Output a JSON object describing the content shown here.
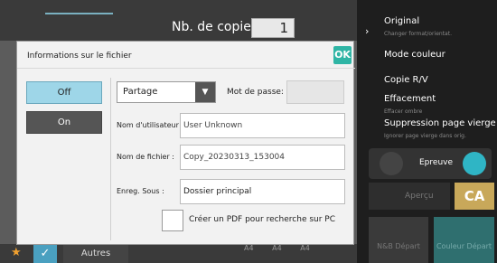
{
  "background": {
    "copies_label": "Nb. de copies",
    "copies_value": "1",
    "right_panel": {
      "original_label": "Original",
      "original_sub": "Changer format/orientat.",
      "mode_couleur": "Mode couleur",
      "copie_rv": "Copie R/V",
      "effacement": "Effacement",
      "effacement_sub": "Effacer ombre",
      "suppression": "Suppression page vierge",
      "suppression_sub": "Ignorer page vierge dans orig.",
      "epreuve": "Epreuve",
      "apercu": "Aperçu",
      "ca": "CA",
      "nb_depart": "N&B Départ",
      "couleur_depart": "Couleur Départ"
    },
    "bottom": {
      "autres": "Autres",
      "tiles": [
        "A4",
        "A4",
        "A4"
      ]
    }
  },
  "dialog": {
    "title": "Informations sur le fichier",
    "ok_label": "OK",
    "off_label": "Off",
    "on_label": "On",
    "select_value": "Partage",
    "password_label": "Mot de passe:",
    "username_label": "Nom d'utilisateur :",
    "username_value": "User Unknown",
    "filename_label": "Nom de fichier   :",
    "filename_value": "Copy_20230313_153004",
    "save_label": "Enreg. Sous       :",
    "save_value": "Dossier principal",
    "pdf_label": "Créer un PDF pour recherche sur PC"
  },
  "colors": {
    "accent": "#2fb5a5",
    "off_active": "#9ed6e8",
    "ca": "#c8a85a"
  }
}
